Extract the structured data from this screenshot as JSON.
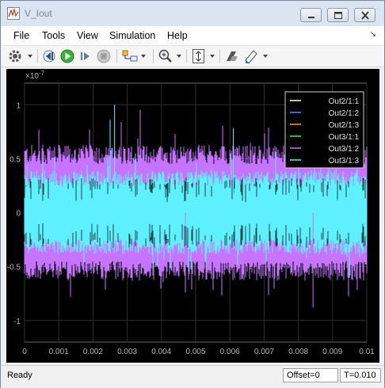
{
  "window": {
    "title": "V_Iout"
  },
  "menu": [
    "File",
    "Tools",
    "View",
    "Simulation",
    "Help"
  ],
  "menu_more": "↘",
  "toolbar_icons": [
    "gear-icon",
    "revert-icon",
    "run-icon",
    "step-forward-icon",
    "stop-icon",
    "signal-select-icon",
    "zoom-icon",
    "fit-axes-icon",
    "style-icon",
    "highlight-icon"
  ],
  "status": {
    "ready": "Ready",
    "offset": "Offset=0",
    "time": "T=0.010"
  },
  "colors": {
    "trace_main": "#5ff0ff",
    "trace_alt": "#c674ff",
    "background": "#000000",
    "grid": "#333333"
  },
  "chart_data": {
    "type": "line",
    "exponent_label": "×10",
    "exponent_power": "-7",
    "x": {
      "min": 0,
      "max": 0.01,
      "ticks": [
        "0",
        "0.001",
        "0.002",
        "0.003",
        "0.004",
        "0.005",
        "0.006",
        "0.007",
        "0.008",
        "0.009",
        "0.01"
      ]
    },
    "y": {
      "min": -1.2,
      "max": 1.2,
      "ticks": [
        1,
        0.5,
        0,
        -0.5,
        -1
      ],
      "tick_labels": [
        "1",
        "0.5",
        "0",
        "-0.5",
        "-1"
      ],
      "units_scale": "1e-7"
    },
    "band": {
      "core_amplitude": 0.45,
      "spike_max": 1.0,
      "spike_min": -0.9
    },
    "legend": {
      "placement": "top-right",
      "entries": [
        {
          "name": "Out2/1:1",
          "color": "#ffffff"
        },
        {
          "name": "Out2/1:2",
          "color": "#4d8cff"
        },
        {
          "name": "Out2/1:3",
          "color": "#ff9a3d"
        },
        {
          "name": "Out3/1:1",
          "color": "#57e36a"
        },
        {
          "name": "Out3/1:2",
          "color": "#c674ff"
        },
        {
          "name": "Out3/1:3",
          "color": "#5ff0ff"
        }
      ]
    }
  }
}
